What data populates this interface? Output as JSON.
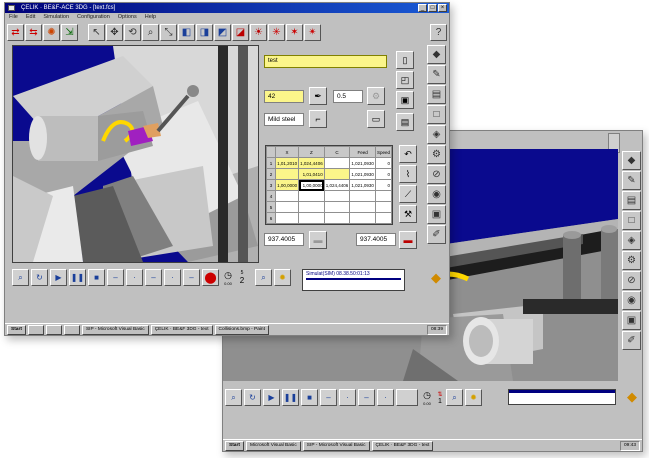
{
  "front": {
    "title": "ÇELIK · BE&F-ACE 3DG - [text.fcs]",
    "menu": [
      "File",
      "Edit",
      "Simulation",
      "Configuration",
      "Options",
      "Help"
    ],
    "panel": {
      "text_label": "test",
      "field_a": "42",
      "field_b": "0.5",
      "material": "Mild steel",
      "coord_left": "937.4005",
      "coord_right": "937.4005"
    },
    "grid": {
      "headers": [
        "X",
        "Z",
        "C",
        "Feed",
        "Speed"
      ],
      "rows": [
        [
          "1",
          "1,01,2010",
          "1,024,4406",
          "",
          "1,021,0930",
          "0"
        ],
        [
          "2",
          "",
          "1,01,0410",
          "",
          "1,021,0930",
          "0"
        ],
        [
          "3",
          "1,00,0000",
          "1,00,0000",
          "1,024,4406",
          "1,021,0930",
          "0"
        ],
        [
          "4",
          "",
          "",
          "",
          "",
          ""
        ],
        [
          "5",
          "",
          "",
          "",
          "",
          ""
        ],
        [
          "6",
          "",
          "",
          "",
          "",
          ""
        ]
      ]
    },
    "playbar": {
      "counter_top": "5",
      "counter_label": "0.00",
      "step_count": "2",
      "status_line": "Simulat(SIM) 08.38.50:01:13"
    },
    "taskbar": {
      "start": "Start",
      "tasks": [
        "",
        "",
        "",
        "SIP - Microsoft Visual Basic",
        "ÇELIK · BE&F 3DG - text",
        "Collisions.bmp - Paint"
      ],
      "clock": "08:39"
    }
  },
  "back": {
    "playbar": {
      "counter_label": "0.00",
      "step_count": "1"
    },
    "taskbar": {
      "start": "Start",
      "tasks": [
        "Microsoft Visual Basic",
        "SIP - Microsoft Visual Basic",
        "ÇELIK · BE&F 3DG - text"
      ],
      "clock": "09:43"
    }
  },
  "colors": {
    "viewport_blue": "#0a0a8e",
    "field_yellow": "#fbf58a",
    "window_gray": "#c0c0c0",
    "titlebar_blue": "#000078"
  }
}
